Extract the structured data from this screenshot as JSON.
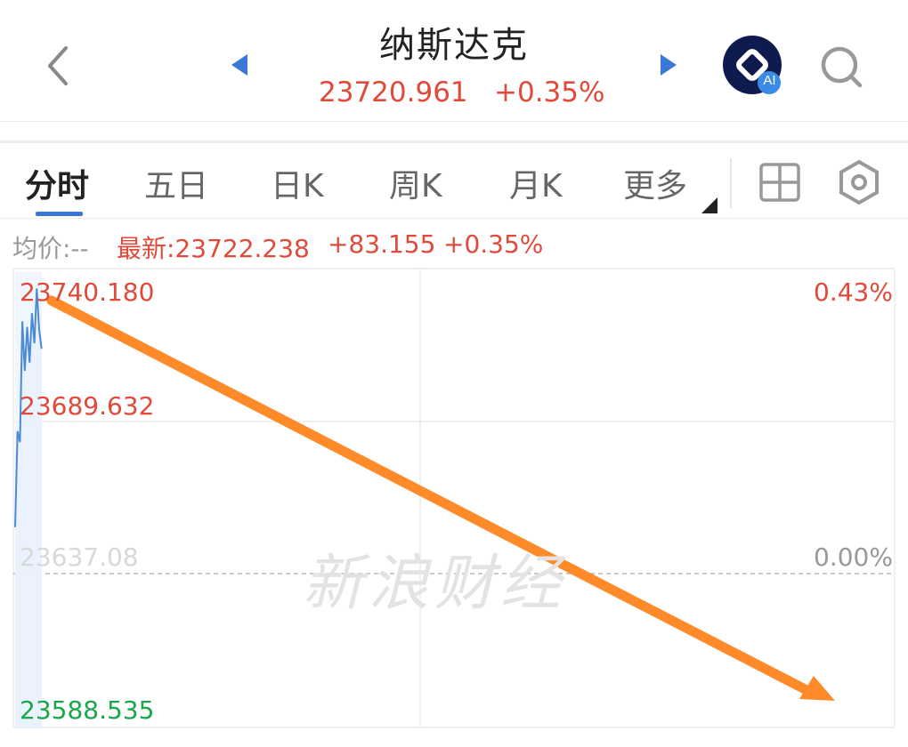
{
  "header": {
    "title": "纳斯达克",
    "price": "23720.961",
    "change_pct": "+0.35%",
    "icons": {
      "back": "chevron-left-icon",
      "prev": "triangle-left-icon",
      "next": "triangle-right-icon",
      "ai": "ai-assistant-icon",
      "search": "search-icon"
    },
    "ai_badge": "AI"
  },
  "tabs": [
    {
      "label": "分时",
      "active": true
    },
    {
      "label": "五日"
    },
    {
      "label": "日K"
    },
    {
      "label": "周K"
    },
    {
      "label": "月K"
    },
    {
      "label": "更多"
    }
  ],
  "toolbar_icons": {
    "layout": "grid-icon",
    "settings": "hexagon-settings-icon"
  },
  "info": {
    "avg_label": "均价:--",
    "latest_label": "最新:23722.238",
    "latest_change": "+83.155",
    "latest_pct": "+0.35%"
  },
  "chart_data": {
    "type": "line",
    "y_left_labels": [
      "23740.180",
      "23689.632",
      "23588.535"
    ],
    "y_left_obscured_label": "23637.08",
    "y_right_labels": [
      "0.43%",
      "0.00%"
    ],
    "y_range": [
      23588.535,
      23740.18
    ],
    "baseline": 23637.08,
    "series": [
      {
        "values": [
          23655,
          23690,
          23686,
          23730,
          23712,
          23728,
          23715,
          23733,
          23722,
          23742,
          23727,
          23720
        ]
      }
    ],
    "annotation": "orange downward arrow from top-left to bottom-right",
    "watermark": "新浪财经",
    "colors": {
      "up": "#e04a3a",
      "down": "#1aa64a",
      "line": "#4a8ad8",
      "arrow": "#ff8a2a"
    }
  }
}
